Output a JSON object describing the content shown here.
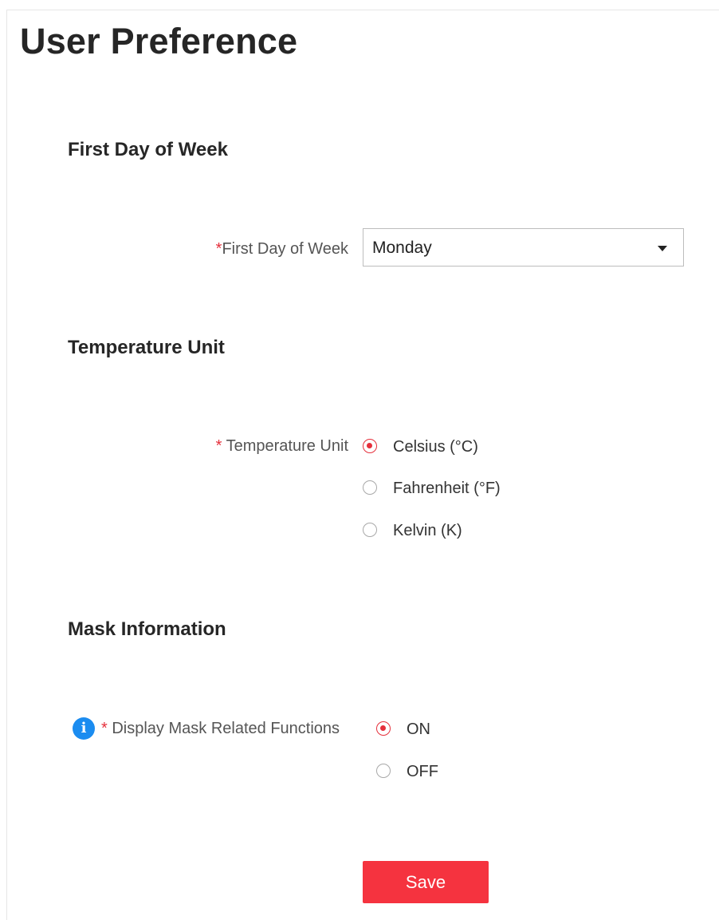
{
  "page": {
    "title": "User Preference"
  },
  "sections": {
    "first_day": {
      "title": "First Day of Week",
      "field_required_mark": "*",
      "field_label": "First Day of Week",
      "selected_value": "Monday"
    },
    "temperature": {
      "title": "Temperature Unit",
      "field_required_mark": "*",
      "field_label": " Temperature Unit",
      "options": [
        {
          "label": "Celsius (°C)",
          "checked": true
        },
        {
          "label": "Fahrenheit (°F)",
          "checked": false
        },
        {
          "label": "Kelvin (K)",
          "checked": false
        }
      ]
    },
    "mask": {
      "title": "Mask Information",
      "info_icon": "info-icon",
      "info_glyph": "i",
      "field_required_mark": "*",
      "field_label": " Display Mask Related Functions",
      "options": [
        {
          "label": "ON",
          "checked": true
        },
        {
          "label": "OFF",
          "checked": false
        }
      ]
    }
  },
  "actions": {
    "save_label": "Save"
  },
  "colors": {
    "accent": "#f5333f",
    "required": "#e5303c",
    "info": "#1b8cf0"
  }
}
